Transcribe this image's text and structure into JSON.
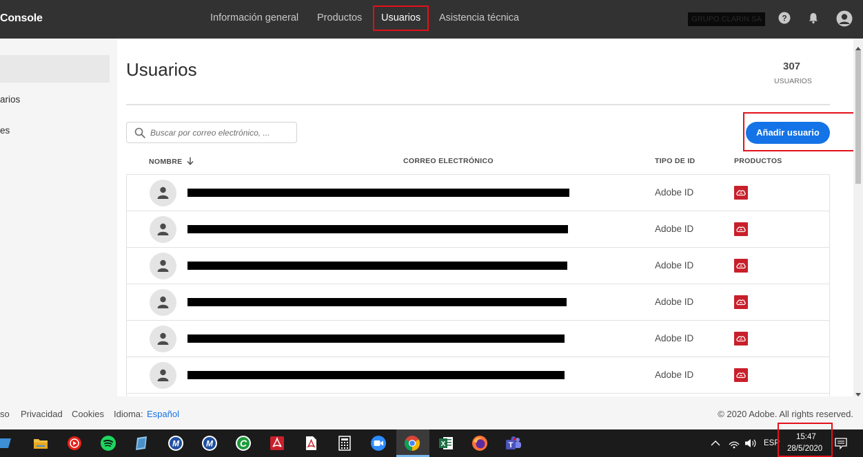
{
  "header": {
    "brand": "Console",
    "nav": [
      {
        "label": "Información general"
      },
      {
        "label": "Productos"
      },
      {
        "label": "Usuarios"
      },
      {
        "label": "Asistencia técnica"
      }
    ],
    "org_name": "GRUPO CLARIN SA"
  },
  "sidebar": {
    "items": [
      {
        "label": "arios"
      },
      {
        "label": "es"
      }
    ]
  },
  "main": {
    "title": "Usuarios",
    "user_count": "307",
    "user_count_label": "USUARIOS",
    "search_placeholder": "Buscar por correo electrónico, ...",
    "add_user_label": "Añadir usuario",
    "columns": {
      "name": "NOMBRE",
      "email": "CORREO ELECTRÓNICO",
      "id_type": "TIPO DE ID",
      "products": "PRODUCTOS"
    },
    "rows": [
      {
        "id_type": "Adobe ID"
      },
      {
        "id_type": "Adobe ID"
      },
      {
        "id_type": "Adobe ID"
      },
      {
        "id_type": "Adobe ID"
      },
      {
        "id_type": "Adobe ID"
      },
      {
        "id_type": "Adobe ID"
      }
    ]
  },
  "footer": {
    "terms_fragment": "so",
    "privacy": "Privacidad",
    "cookies": "Cookies",
    "language_label": "Idioma:",
    "language_value": "Español",
    "copyright": "© 2020 Adobe. All rights reserved."
  },
  "taskbar": {
    "language": "ESP",
    "time": "15:47",
    "date": "28/5/2020"
  },
  "colors": {
    "accent": "#1473e6",
    "highlight": "#e3101a",
    "creative_cloud": "#c8202b",
    "header_bg": "#323232"
  }
}
